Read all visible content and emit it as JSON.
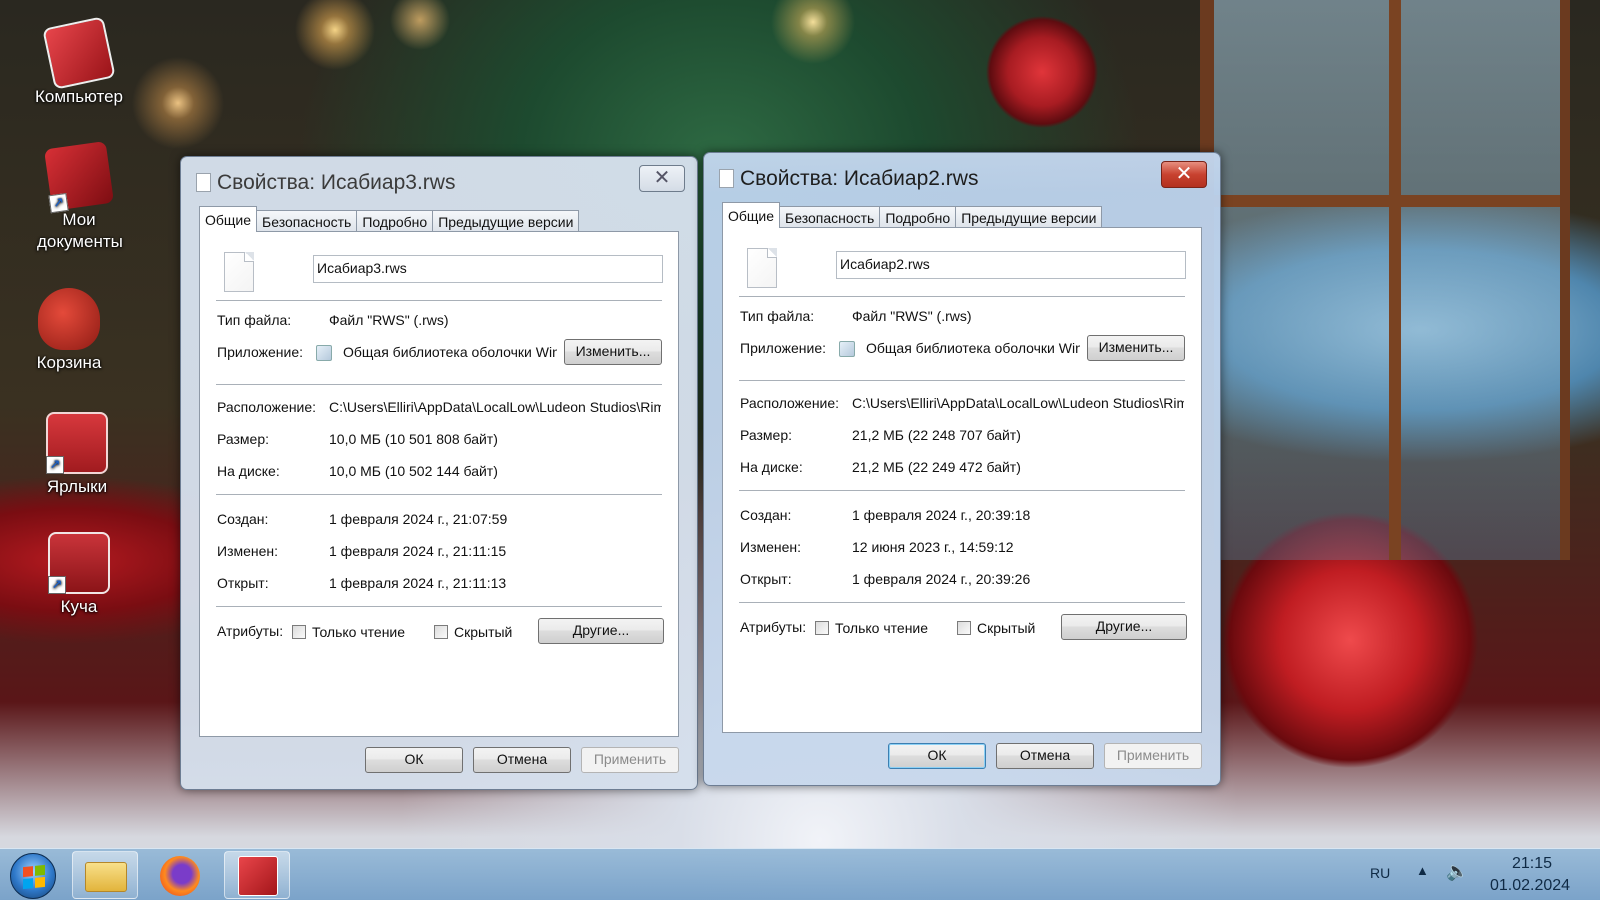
{
  "desktop": {
    "icons": [
      {
        "label": "Компьютер",
        "icon": "computer-icon"
      },
      {
        "label": "Мои документы",
        "icon": "documents-icon"
      },
      {
        "label": "Корзина",
        "icon": "recycle-bin-icon"
      },
      {
        "label": "Ярлыки",
        "icon": "shortcuts-folder-icon"
      },
      {
        "label": "Куча",
        "icon": "folder-icon"
      }
    ]
  },
  "window_left": {
    "title": "Свойства: Исабиар3.rws",
    "close": "✕",
    "tabs": [
      "Общие",
      "Безопасность",
      "Подробно",
      "Предыдущие версии"
    ],
    "file_name": "Исабиар3.rws",
    "labels": {
      "type": "Тип файла:",
      "app": "Приложение:",
      "location": "Расположение:",
      "size": "Размер:",
      "on_disk": "На диске:",
      "created": "Создан:",
      "modified": "Изменен:",
      "opened": "Открыт:",
      "attributes": "Атрибуты:"
    },
    "values": {
      "type": "Файл \"RWS\" (.rws)",
      "app": "Общая библиотека оболочки Win",
      "location": "C:\\Users\\Elliri\\AppData\\LocalLow\\Ludeon Studios\\RimW",
      "size": "10,0 МБ (10 501 808 байт)",
      "on_disk": "10,0 МБ (10 502 144 байт)",
      "created": "1 февраля 2024 г., 21:07:59",
      "modified": "1 февраля 2024 г., 21:11:15",
      "opened": "1 февраля 2024 г., 21:11:13"
    },
    "buttons": {
      "change": "Изменить...",
      "other": "Другие...",
      "ok": "ОК",
      "cancel": "Отмена",
      "apply": "Применить"
    },
    "checkboxes": {
      "readonly": "Только чтение",
      "hidden": "Скрытый"
    }
  },
  "window_right": {
    "title": "Свойства: Исабиар2.rws",
    "close": "✕",
    "tabs": [
      "Общие",
      "Безопасность",
      "Подробно",
      "Предыдущие версии"
    ],
    "file_name": "Исабиар2.rws",
    "labels": {
      "type": "Тип файла:",
      "app": "Приложение:",
      "location": "Расположение:",
      "size": "Размер:",
      "on_disk": "На диске:",
      "created": "Создан:",
      "modified": "Изменен:",
      "opened": "Открыт:",
      "attributes": "Атрибуты:"
    },
    "values": {
      "type": "Файл \"RWS\" (.rws)",
      "app": "Общая библиотека оболочки Win",
      "location": "C:\\Users\\Elliri\\AppData\\LocalLow\\Ludeon Studios\\RimW",
      "size": "21,2 МБ (22 248 707 байт)",
      "on_disk": "21,2 МБ (22 249 472 байт)",
      "created": "1 февраля 2024 г., 20:39:18",
      "modified": "12 июня 2023 г., 14:59:12",
      "opened": "1 февраля 2024 г., 20:39:26"
    },
    "buttons": {
      "change": "Изменить...",
      "other": "Другие...",
      "ok": "ОК",
      "cancel": "Отмена",
      "apply": "Применить"
    },
    "checkboxes": {
      "readonly": "Только чтение",
      "hidden": "Скрытый"
    }
  },
  "taskbar": {
    "language": "RU",
    "time": "21:15",
    "date": "01.02.2024",
    "apps": [
      "start-orb-icon",
      "file-explorer-icon",
      "firefox-icon",
      "pinned-app-icon"
    ]
  }
}
